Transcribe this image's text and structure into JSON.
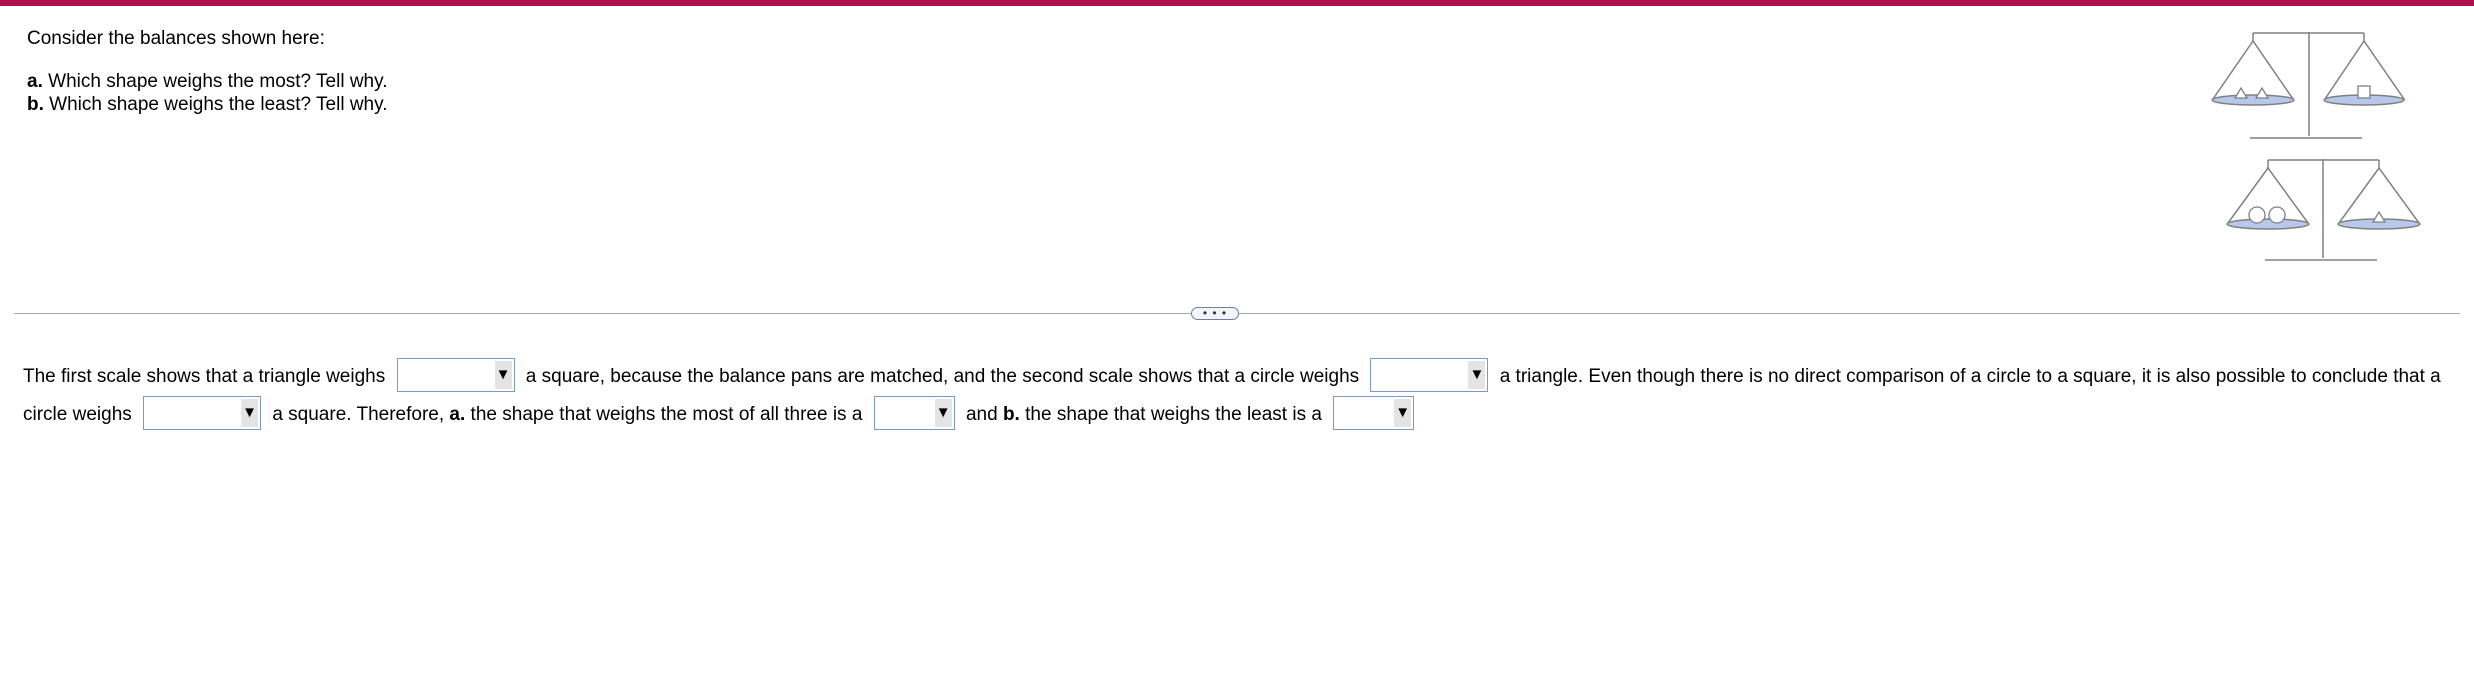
{
  "question": {
    "intro": "Consider the balances shown here:",
    "part_a_label": "a.",
    "part_a_text": " Which shape weighs the most? Tell why.",
    "part_b_label": "b.",
    "part_b_text": " Which shape weighs the least? Tell why."
  },
  "figure": {
    "scale1": {
      "left_pan": [
        "triangle",
        "triangle"
      ],
      "right_pan": [
        "square"
      ],
      "state": "balanced"
    },
    "scale2": {
      "left_pan": [
        "circle",
        "circle"
      ],
      "right_pan": [
        "triangle"
      ],
      "state": "balanced"
    },
    "pan_color": "#b7c8ea"
  },
  "divider": {
    "more_label": "• • •"
  },
  "answer": {
    "t1": "The first scale shows that a triangle weighs ",
    "t2": " a square, because the balance pans are matched, and the second scale shows that a circle weighs ",
    "t3": " a triangle. Even though there is no direct comparison of a circle to a square, it is also possible to conclude that a circle weighs ",
    "t4": " a square. Therefore, ",
    "a_label": "a.",
    "t5": " the shape that weighs the most of all three is a ",
    "t6": " and ",
    "b_label": "b.",
    "t7": " the shape that weighs the least is a ",
    "dropdown_arrow": "▼",
    "dropdowns": [
      {
        "selected": ""
      },
      {
        "selected": ""
      },
      {
        "selected": ""
      },
      {
        "selected": ""
      },
      {
        "selected": ""
      }
    ]
  }
}
